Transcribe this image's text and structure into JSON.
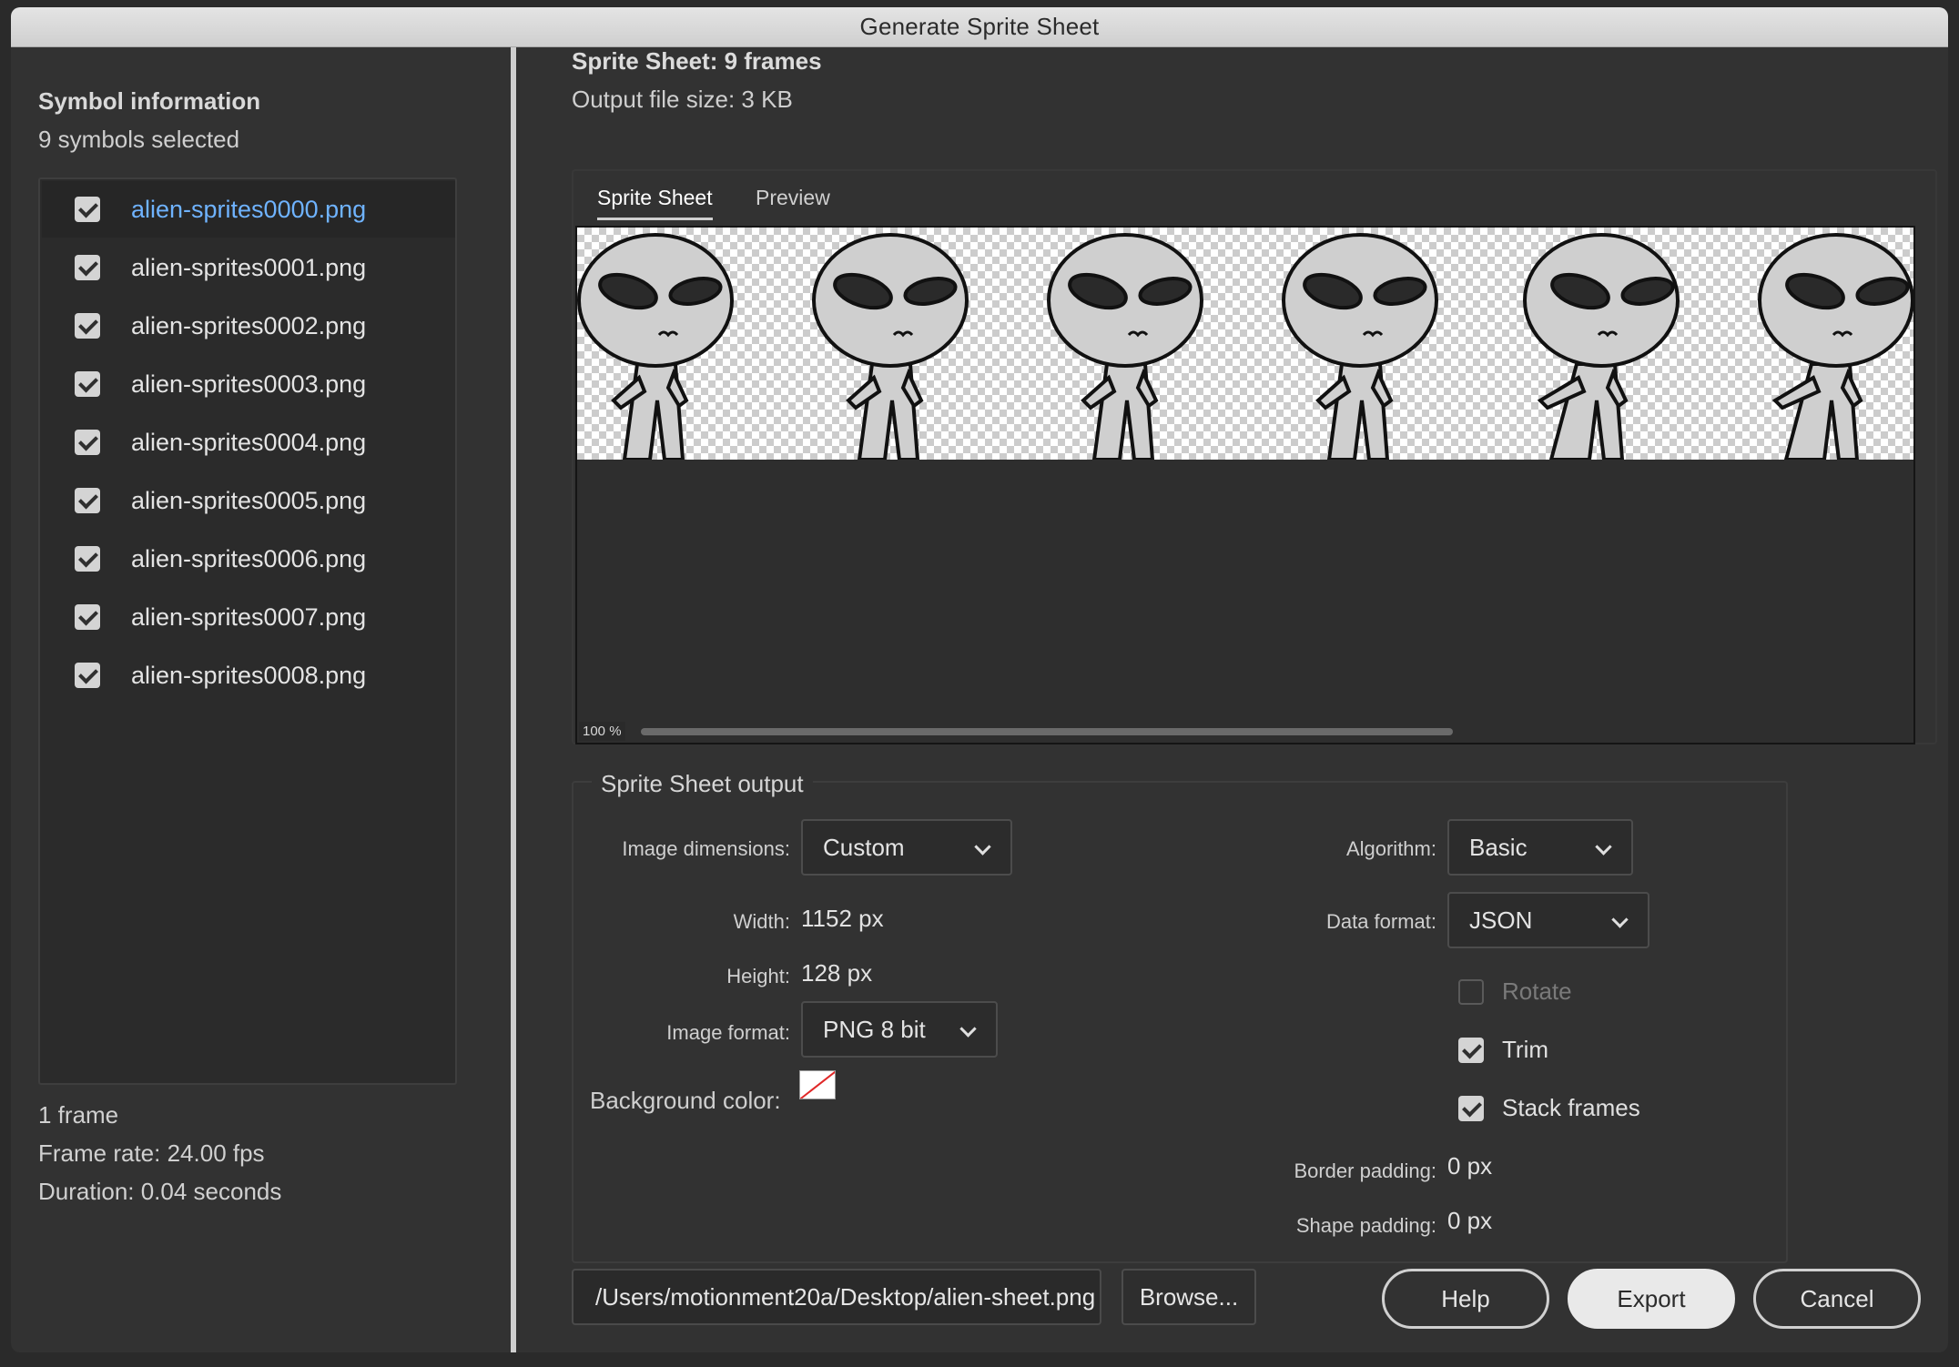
{
  "window": {
    "title": "Generate Sprite Sheet"
  },
  "symbols": {
    "title": "Symbol information",
    "count": "9 symbols selected",
    "items": [
      {
        "label": "alien-sprites0000.png",
        "checked": true,
        "selected": true
      },
      {
        "label": "alien-sprites0001.png",
        "checked": true
      },
      {
        "label": "alien-sprites0002.png",
        "checked": true
      },
      {
        "label": "alien-sprites0003.png",
        "checked": true
      },
      {
        "label": "alien-sprites0004.png",
        "checked": true
      },
      {
        "label": "alien-sprites0005.png",
        "checked": true
      },
      {
        "label": "alien-sprites0006.png",
        "checked": true
      },
      {
        "label": "alien-sprites0007.png",
        "checked": true
      },
      {
        "label": "alien-sprites0008.png",
        "checked": true
      }
    ],
    "frames": "1 frame",
    "frame_rate": "Frame rate: 24.00 fps",
    "duration": "Duration: 0.04 seconds"
  },
  "sheet": {
    "title": "Sprite Sheet: 9 frames",
    "file_size": "Output file size: 3 KB",
    "tabs": [
      {
        "label": "Sprite Sheet",
        "active": true
      },
      {
        "label": "Preview",
        "active": false
      }
    ],
    "zoom": "100 %",
    "preview_sprites": 6
  },
  "output": {
    "group_title": "Sprite Sheet output",
    "image_dimensions_label": "Image dimensions:",
    "image_dimensions_value": "Custom",
    "width_label": "Width:",
    "width_value": "1152 px",
    "height_label": "Height:",
    "height_value": "128 px",
    "image_format_label": "Image format:",
    "image_format_value": "PNG 8 bit",
    "background_color_label": "Background color:",
    "algorithm_label": "Algorithm:",
    "algorithm_value": "Basic",
    "data_format_label": "Data format:",
    "data_format_value": "JSON",
    "rotate_label": "Rotate",
    "rotate_checked": false,
    "trim_label": "Trim",
    "trim_checked": true,
    "stack_label": "Stack frames",
    "stack_checked": true,
    "border_padding_label": "Border padding:",
    "border_padding_value": "0 px",
    "shape_padding_label": "Shape padding:",
    "shape_padding_value": "0 px"
  },
  "footer": {
    "path": "/Users/motionment20a/Desktop/alien-sheet.png",
    "browse": "Browse...",
    "help": "Help",
    "export": "Export",
    "cancel": "Cancel"
  },
  "colors": {
    "accent_link": "#6fb3ff",
    "background": "#323232"
  }
}
